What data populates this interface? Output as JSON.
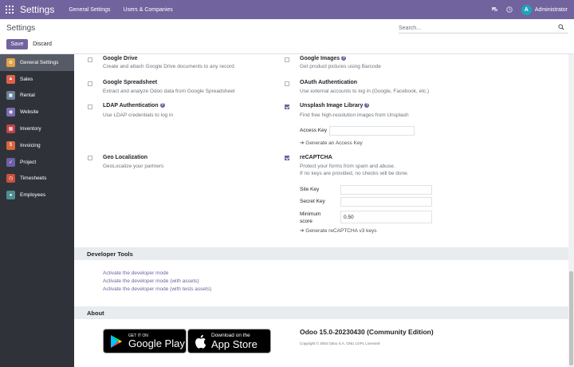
{
  "navbar": {
    "app_name": "Settings",
    "menus": [
      "General Settings",
      "Users & Companies"
    ],
    "user_initial": "A",
    "user_name": "Administrator"
  },
  "control": {
    "title": "Settings",
    "search_placeholder": "Search...",
    "save_label": "Save",
    "discard_label": "Discard"
  },
  "sidebar": {
    "items": [
      {
        "label": "General Settings",
        "color": "#e1a342"
      },
      {
        "label": "Sales",
        "color": "#e0604a"
      },
      {
        "label": "Rental",
        "color": "#6b7f9d"
      },
      {
        "label": "Website",
        "color": "#7a6cb3"
      },
      {
        "label": "Inventory",
        "color": "#c0434b"
      },
      {
        "label": "Invoicing",
        "color": "#d9663d"
      },
      {
        "label": "Project",
        "color": "#6f5fa8"
      },
      {
        "label": "Timesheets",
        "color": "#c9503d"
      },
      {
        "label": "Employees",
        "color": "#4e8e92"
      }
    ]
  },
  "settings": {
    "google_drive": {
      "title": "Google Drive",
      "desc": "Create and attach Google Drive documents to any record"
    },
    "google_images": {
      "title": "Google Images",
      "desc": "Get product pictures using Barcode"
    },
    "google_spreadsheet": {
      "title": "Google Spreadsheet",
      "desc": "Extract and analyze Odoo data from Google Spreadsheet"
    },
    "oauth": {
      "title": "OAuth Authentication",
      "desc": "Use external accounts to log in (Google, Facebook, etc.)"
    },
    "ldap": {
      "title": "LDAP Authentication",
      "desc": "Use LDAP credentials to log in"
    },
    "unsplash": {
      "title": "Unsplash Image Library",
      "desc": "Find free high-resolution images from Unsplash",
      "access_key_label": "Access Key",
      "access_key_value": "",
      "generate_link": "Generate an Access Key"
    },
    "geo": {
      "title": "Geo Localization",
      "desc": "GeoLocalize your partners"
    },
    "recaptcha": {
      "title": "reCAPTCHA",
      "desc1": "Protect your forms from spam and abuse.",
      "desc2": "If no keys are provided, no checks will be done.",
      "site_key_label": "Site Key",
      "secret_key_label": "Secret Key",
      "min_score_label_1": "Minimum",
      "min_score_label_2": "score",
      "min_score_value": "0.50",
      "generate_link": "Generate reCAPTCHA v3 keys"
    }
  },
  "developer_tools": {
    "heading": "Developer Tools",
    "links": [
      "Activate the developer mode",
      "Activate the developer mode (with assets)",
      "Activate the developer mode (with tests assets)"
    ]
  },
  "about": {
    "heading": "About",
    "google_play_small": "GET IT ON",
    "google_play_big": "Google Play",
    "app_store_small": "Download on the",
    "app_store_big": "App Store",
    "version": "Odoo 15.0-20230430 (Community Edition)",
    "copyright": "Copyright © 2004 Odoo S.A. GNU LGPL Licensed"
  }
}
